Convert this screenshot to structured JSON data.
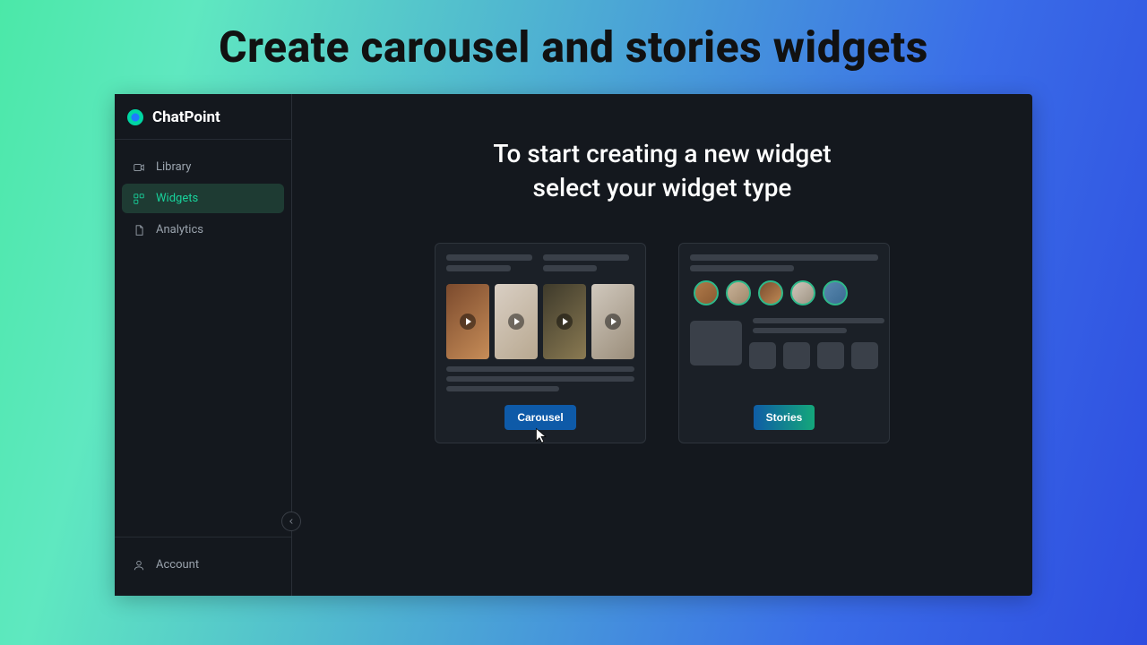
{
  "page": {
    "headline": "Create carousel and stories widgets"
  },
  "brand": {
    "name": "ChatPoint"
  },
  "sidebar": {
    "items": [
      {
        "label": "Library",
        "icon": "video-icon",
        "active": false
      },
      {
        "label": "Widgets",
        "icon": "widgets-icon",
        "active": true
      },
      {
        "label": "Analytics",
        "icon": "document-icon",
        "active": false
      }
    ],
    "footer": {
      "label": "Account",
      "icon": "user-icon"
    }
  },
  "main": {
    "title_line1": "To start creating a new widget",
    "title_line2": "select your widget type",
    "options": {
      "carousel": {
        "label": "Carousel"
      },
      "stories": {
        "label": "Stories"
      }
    }
  }
}
